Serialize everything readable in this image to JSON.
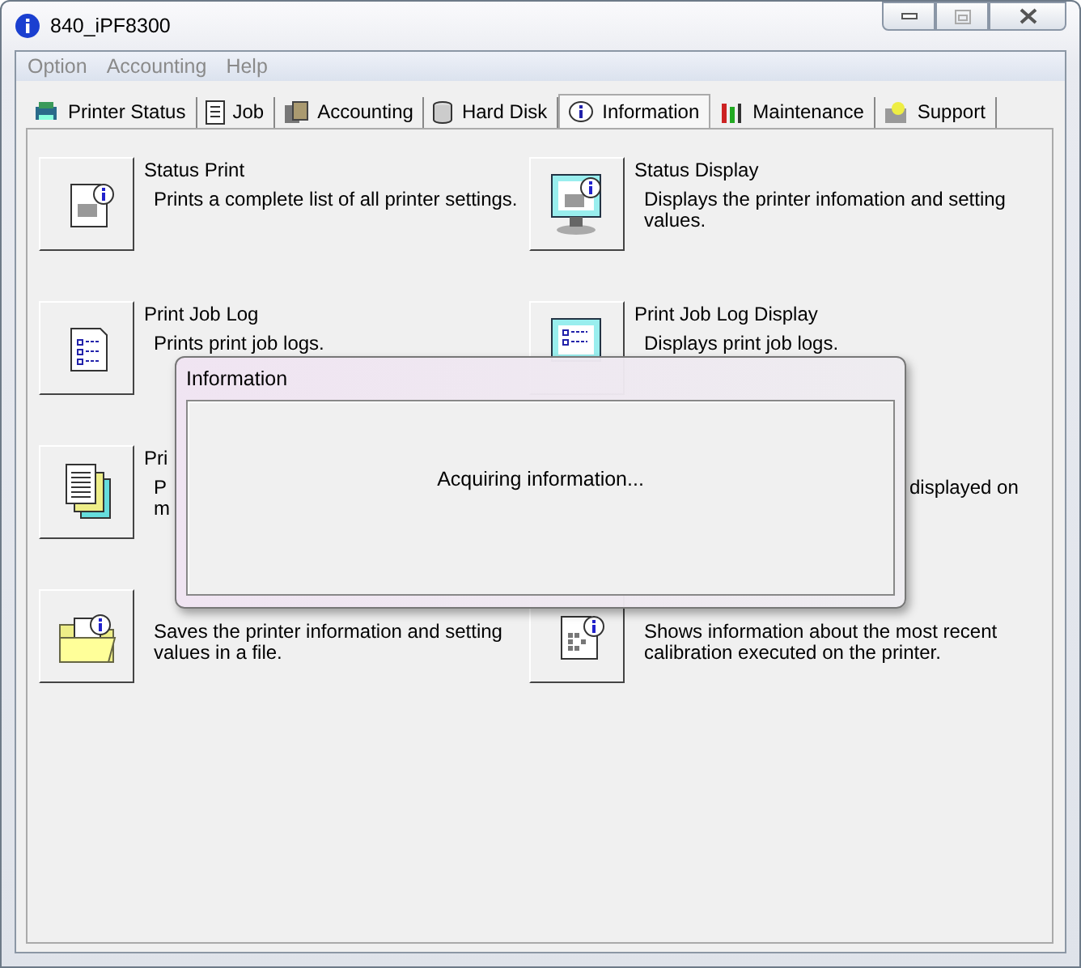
{
  "window": {
    "title": "840_iPF8300"
  },
  "menu": [
    "Option",
    "Accounting",
    "Help"
  ],
  "tabs": [
    {
      "label": "Printer Status",
      "selected": false
    },
    {
      "label": "Job",
      "selected": false
    },
    {
      "label": "Accounting",
      "selected": false
    },
    {
      "label": "Hard Disk",
      "selected": false
    },
    {
      "label": "Information",
      "selected": true
    },
    {
      "label": "Maintenance",
      "selected": false
    },
    {
      "label": "Support",
      "selected": false
    }
  ],
  "items": [
    {
      "title": "Status Print",
      "lines": [
        "Prints a complete list of all printer settings."
      ]
    },
    {
      "title": "Status Display",
      "lines": [
        "Displays the printer infomation and setting",
        "values."
      ]
    },
    {
      "title": "Print Job Log",
      "lines": [
        "Prints print job logs."
      ]
    },
    {
      "title": "Print Job Log Display",
      "lines": [
        "Displays print job logs."
      ]
    },
    {
      "title": "Pri",
      "lines": [
        "P",
        "m"
      ]
    },
    {
      "lines": [
        "displayed on"
      ]
    },
    {
      "lines": [
        "Saves the printer information and setting",
        "values in a file."
      ]
    },
    {
      "lines": [
        "Shows information about the most recent",
        "calibration executed on the printer."
      ]
    }
  ],
  "dialog": {
    "title": "Information",
    "message": "Acquiring information..."
  }
}
